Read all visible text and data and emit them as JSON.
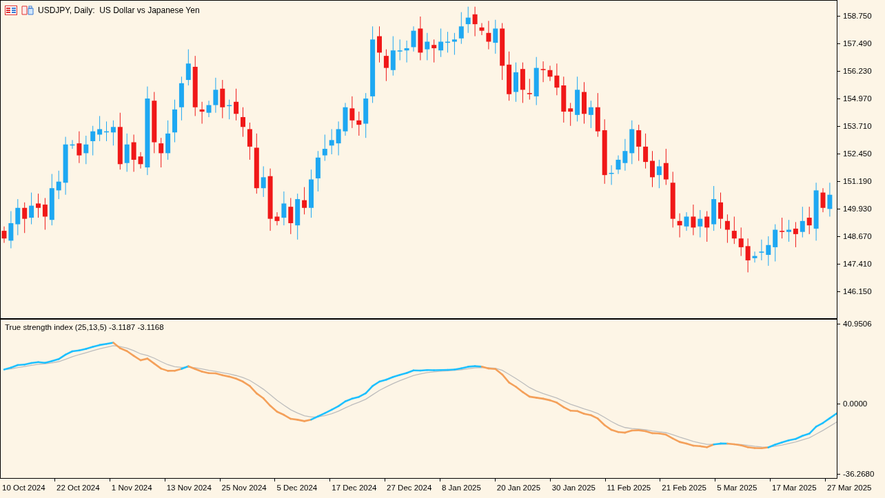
{
  "chart": {
    "title": "USDJPY, Daily:  US Dollar vs Japanese Yen",
    "price_ticks": [
      "158.750",
      "157.490",
      "156.230",
      "154.970",
      "153.710",
      "152.450",
      "151.190",
      "149.930",
      "148.670",
      "147.410",
      "146.150"
    ]
  },
  "indicator": {
    "title": "True strength index (25,13,5) -3.1187 -3.1168",
    "ticks": [
      "40.9506",
      "0.0000",
      "-36.2680"
    ]
  },
  "time_axis": [
    "10 Oct 2024",
    "22 Oct 2024",
    "1 Nov 2024",
    "13 Nov 2024",
    "25 Nov 2024",
    "5 Dec 2024",
    "17 Dec 2024",
    "27 Dec 2024",
    "8 Jan 2025",
    "20 Jan 2025",
    "30 Jan 2025",
    "11 Feb 2025",
    "21 Feb 2025",
    "5 Mar 2025",
    "17 Mar 2025",
    "27 Mar 2025"
  ]
}
